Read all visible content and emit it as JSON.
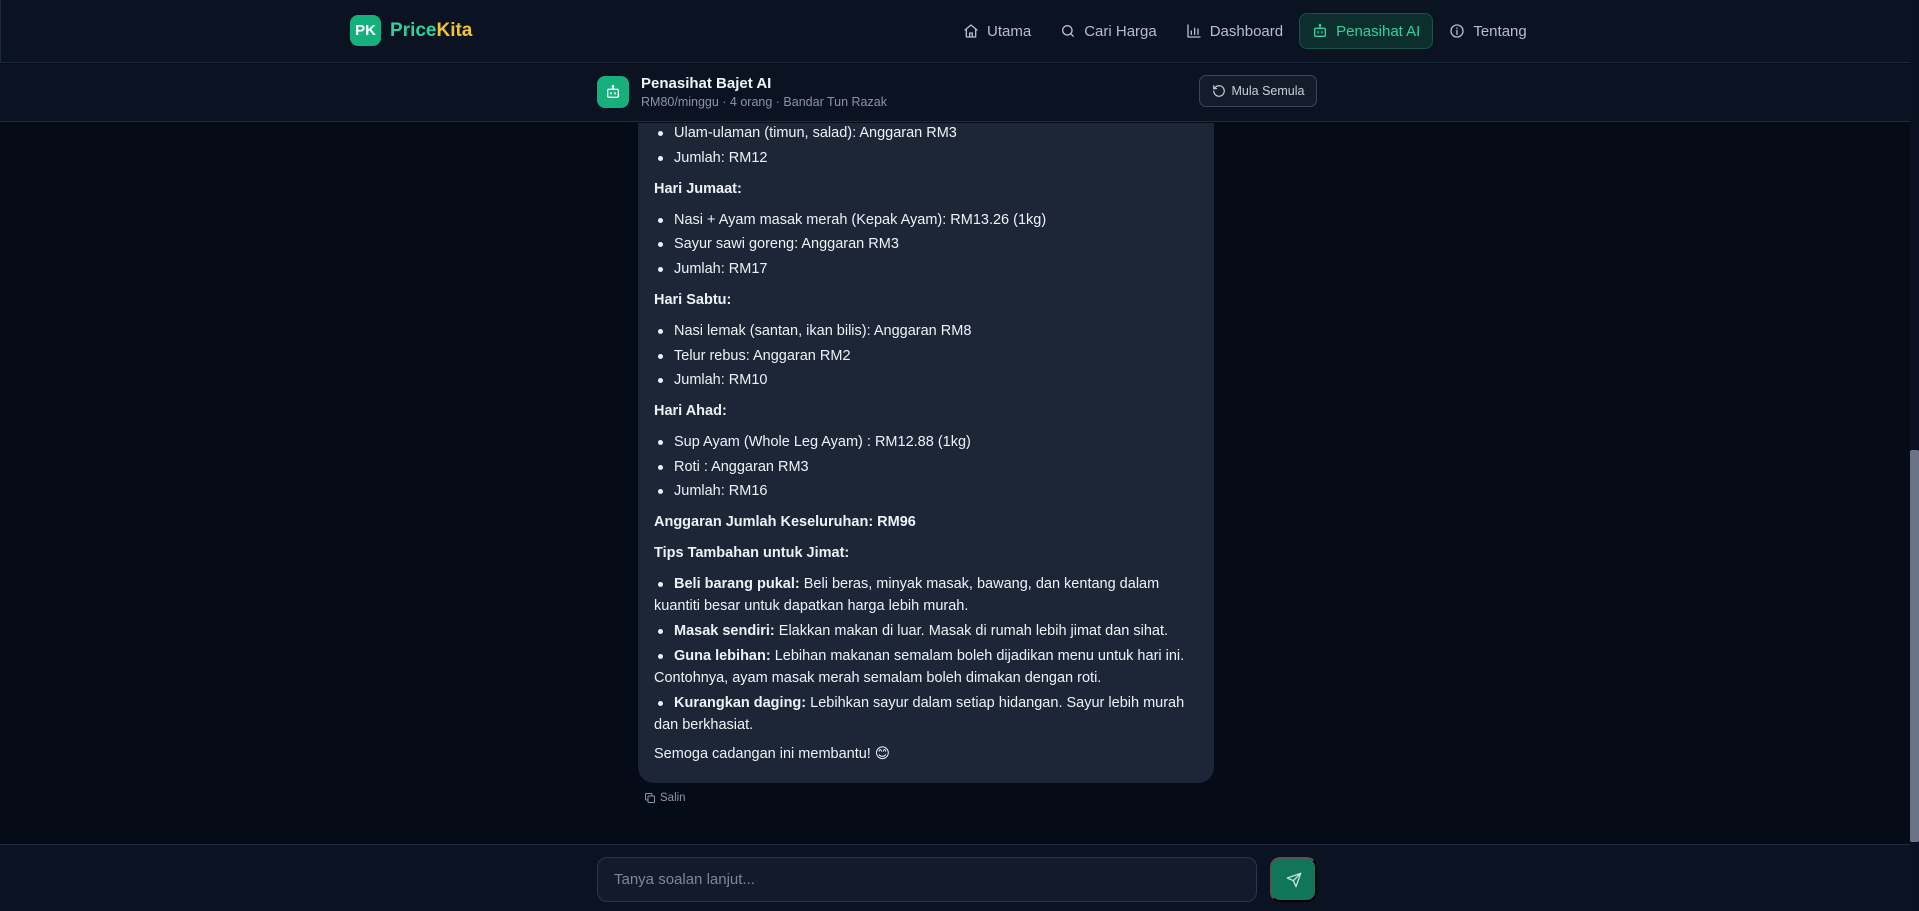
{
  "brand": {
    "badge": "PK",
    "name_part1": "Price",
    "name_part2": "Kita"
  },
  "nav": [
    {
      "label": "Utama",
      "icon": "home-icon"
    },
    {
      "label": "Cari Harga",
      "icon": "search-icon"
    },
    {
      "label": "Dashboard",
      "icon": "bar-chart-icon"
    },
    {
      "label": "Penasihat AI",
      "icon": "bot-icon",
      "active": true
    },
    {
      "label": "Tentang",
      "icon": "info-icon"
    }
  ],
  "chat_header": {
    "title": "Penasihat Bajet AI",
    "subtitle": "RM80/minggu · 4 orang · Bandar Tun Razak",
    "reset_label": "Mula Semula"
  },
  "message": {
    "items": [
      "Ulam-ulaman (timun, salad): Anggaran RM3",
      "Jumlah: RM12",
      "Hari Jumaat:",
      "Nasi + Ayam masak merah (Kepak Ayam): RM13.26 (1kg)",
      "Sayur sawi goreng: Anggaran RM3",
      "Jumlah: RM17",
      "Hari Sabtu:",
      "Nasi lemak (santan, ikan bilis): Anggaran RM8",
      "Telur rebus: Anggaran RM2",
      "Jumlah: RM10",
      "Hari Ahad:",
      "Sup Ayam (Whole Leg Ayam) : RM12.88 (1kg)",
      "Roti : Anggaran RM3",
      "Jumlah: RM16",
      "Anggaran Jumlah Keseluruhan: RM96",
      "Tips Tambahan untuk Jimat:"
    ],
    "tips": [
      {
        "bold": "Beli barang pukal:",
        "text": " Beli beras, minyak masak, bawang, dan kentang dalam kuantiti besar untuk dapatkan harga lebih murah."
      },
      {
        "bold": "Masak sendiri:",
        "text": " Elakkan makan di luar. Masak di rumah lebih jimat dan sihat."
      },
      {
        "bold": "Guna lebihan:",
        "text": " Lebihan makanan semalam boleh dijadikan menu untuk hari ini. Contohnya, ayam masak merah semalam boleh dimakan dengan roti."
      },
      {
        "bold": "Kurangkan daging:",
        "text": " Lebihkan sayur dalam setiap hidangan. Sayur lebih murah dan berkhasiat."
      }
    ],
    "closing": "Semoga cadangan ini membantu! 😊",
    "copy_label": "Salin"
  },
  "composer": {
    "placeholder": "Tanya soalan lanjut..."
  },
  "colors": {
    "accent": "#16b07d",
    "brand_yellow": "#f2c233",
    "background": "#060b18",
    "bubble": "#1c2637"
  }
}
